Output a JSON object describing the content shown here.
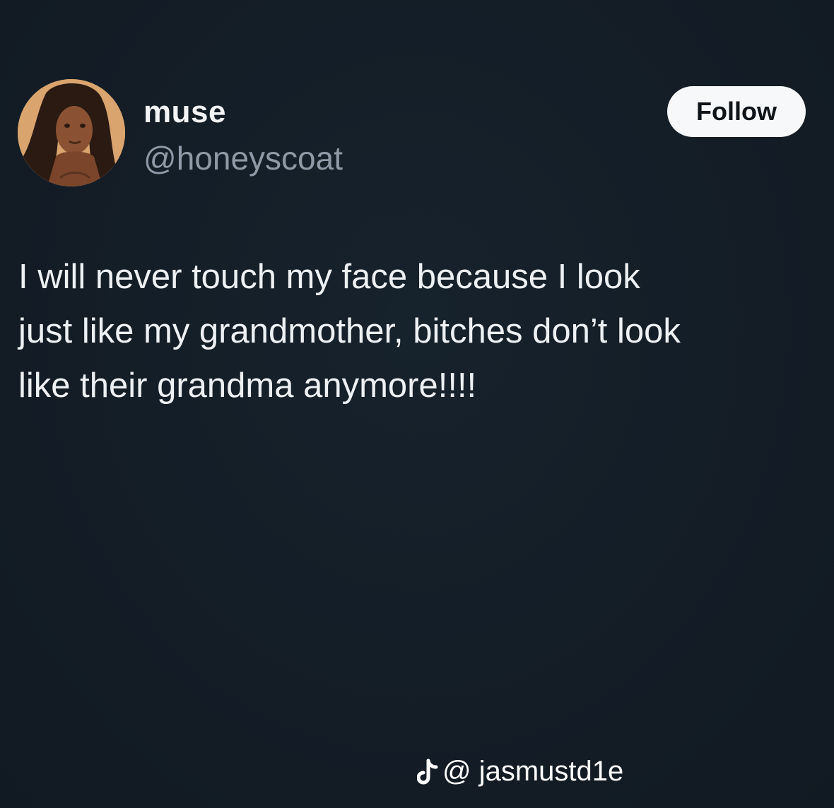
{
  "post": {
    "author": {
      "display_name": "muse",
      "handle": "@honeyscoat",
      "avatar_icon": "avatar-photo"
    },
    "follow_label": "Follow",
    "text": "I will never touch my face because I look\njust like my grandmother, bitches don’t look\nlike their grandma anymore!!!!"
  },
  "watermark": {
    "icon": "tiktok-logo-icon",
    "username": "@ jasmustd1e"
  },
  "colors": {
    "background": "#141e27",
    "primary_text": "#eef1f4",
    "secondary_text": "#8e9aa6",
    "button_bg": "#f7f8f9",
    "button_text": "#0f1419"
  }
}
